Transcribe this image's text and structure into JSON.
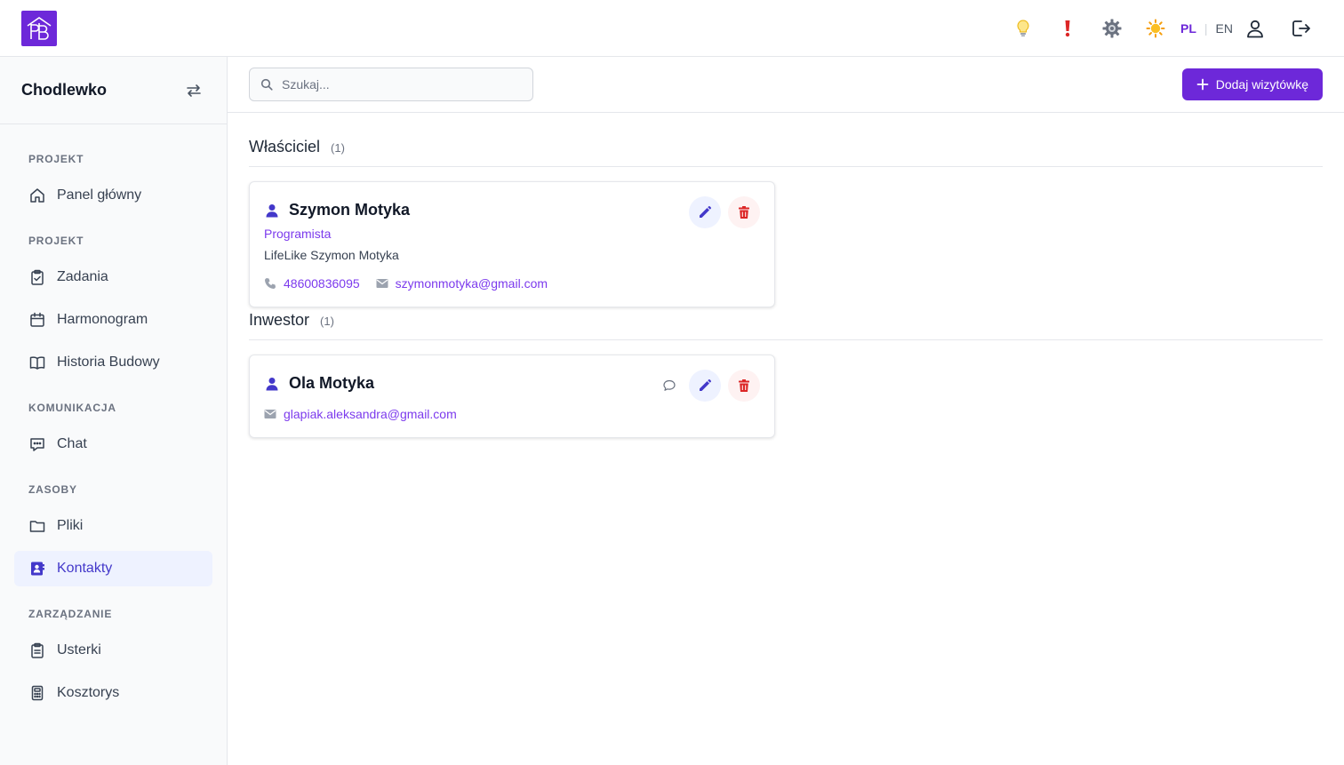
{
  "topbar": {
    "lang_pl": "PL",
    "lang_en": "EN",
    "icons": [
      "lightbulb-icon",
      "exclamation-icon",
      "gear-icon",
      "sun-icon",
      "user-icon",
      "logout-icon"
    ]
  },
  "sidebar": {
    "project_name": "Chodlewko",
    "sections": {
      "projekt1": "PROJEKT",
      "projekt2": "PROJEKT",
      "komunikacja": "KOMUNIKACJA",
      "zasoby": "ZASOBY",
      "zarzadzanie": "ZARZĄDZANIE"
    },
    "items": {
      "panel": "Panel główny",
      "zadania": "Zadania",
      "harmonogram": "Harmonogram",
      "historia": "Historia Budowy",
      "chat": "Chat",
      "pliki": "Pliki",
      "kontakty": "Kontakty",
      "usterki": "Usterki",
      "kosztorys": "Kosztorys"
    },
    "active_item": "kontakty"
  },
  "header": {
    "search_placeholder": "Szukaj...",
    "add_button": "Dodaj wizytówkę"
  },
  "groups": [
    {
      "title": "Właściciel",
      "count": "(1)",
      "contacts": [
        {
          "name": "Szymon Motyka",
          "role": "Programista",
          "company": "LifeLike Szymon Motyka",
          "phone": "48600836095",
          "email": "szymonmotyka@gmail.com"
        }
      ]
    },
    {
      "title": "Inwestor",
      "count": "(1)",
      "contacts": [
        {
          "name": "Ola Motyka",
          "email": "glapiak.aleksandra@gmail.com"
        }
      ]
    }
  ],
  "colors": {
    "accent": "#6d28d9",
    "active_bg": "#eef2ff",
    "active_text": "#4338ca",
    "link": "#7c3aed",
    "delete": "#dc2626"
  }
}
